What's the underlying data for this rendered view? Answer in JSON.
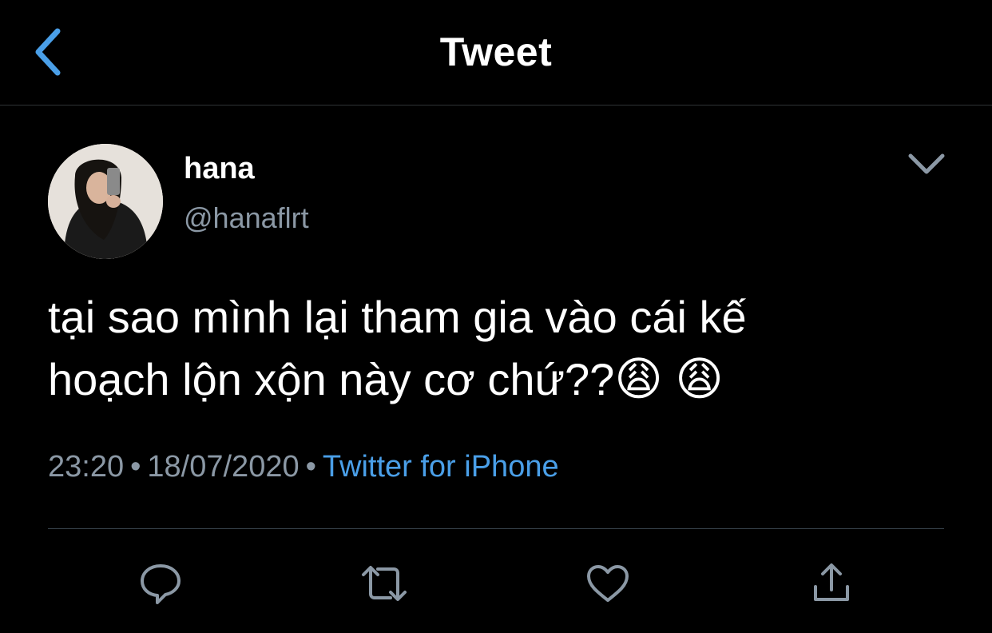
{
  "header": {
    "title": "Tweet",
    "back_icon": "chevron-left-icon"
  },
  "tweet": {
    "author": {
      "display_name": "hana",
      "handle": "@hanaflrt"
    },
    "text_line1": "tại sao mình lại tham gia vào cái kế",
    "text_line2": "hoạch lộn xộn này cơ chứ??",
    "emojis": [
      "😩",
      "😩"
    ],
    "time": "23:20",
    "date": "18/07/2020",
    "separator": "•",
    "source": "Twitter for iPhone"
  },
  "actions": [
    {
      "name": "reply",
      "icon": "reply-icon"
    },
    {
      "name": "retweet",
      "icon": "retweet-icon"
    },
    {
      "name": "like",
      "icon": "heart-icon"
    },
    {
      "name": "share",
      "icon": "share-icon"
    }
  ],
  "colors": {
    "background": "#000000",
    "accent": "#4a9fe8",
    "secondary_text": "#8b98a5",
    "icon_gray": "#8b98a5",
    "divider": "#38444d"
  }
}
